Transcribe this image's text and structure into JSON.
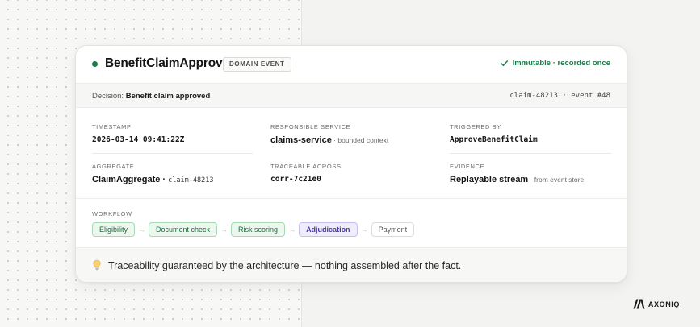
{
  "event": {
    "name": "BenefitClaimApproved",
    "badge": "DOMAIN EVENT",
    "status": "Immutable · recorded once",
    "status_color": "#1f7a4a"
  },
  "decision": {
    "label": "Decision: ",
    "value": "Benefit claim approved",
    "ref": "claim-48213  ·  event #48"
  },
  "fields": {
    "timestamp": {
      "label": "TIMESTAMP",
      "value": "2026-03-14 09:41:22Z"
    },
    "service": {
      "label": "RESPONSIBLE SERVICE",
      "value": "claims-service",
      "sub": " · bounded context"
    },
    "triggered": {
      "label": "TRIGGERED BY",
      "value": "ApproveBenefitClaim"
    },
    "aggregate": {
      "label": "AGGREGATE",
      "value": "ClaimAggregate",
      "sep": " · ",
      "sub": "claim-48213"
    },
    "traceable": {
      "label": "TRACEABLE ACROSS",
      "value": "corr-7c21e0"
    },
    "evidence": {
      "label": "EVIDENCE",
      "value": "Replayable stream",
      "sub": " · from event store"
    }
  },
  "workflow": {
    "label": "WORKFLOW",
    "steps": [
      {
        "label": "Eligibility",
        "state": "done"
      },
      {
        "label": "Document check",
        "state": "done"
      },
      {
        "label": "Risk scoring",
        "state": "done"
      },
      {
        "label": "Adjudication",
        "state": "active"
      },
      {
        "label": "Payment",
        "state": "pending"
      }
    ],
    "arrow": "→"
  },
  "footer": {
    "icon": "lightbulb-icon",
    "text": "Traceability guaranteed by the architecture — nothing assembled after the fact."
  },
  "brand": {
    "name": "AXONIQ",
    "icon": "axoniq-logo-icon"
  }
}
